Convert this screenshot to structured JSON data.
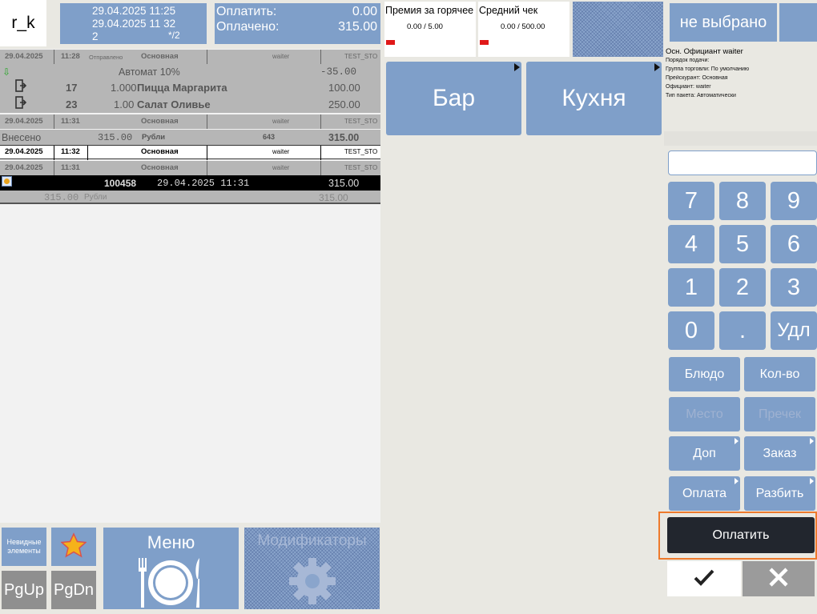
{
  "header": {
    "logo": "r_k",
    "order": {
      "opened": "29.04.2025 11:25",
      "closed": "29.04.2025 11 32",
      "guests": "2",
      "fraction": "*/2"
    },
    "payment": {
      "to_pay_label": "Оплатить:",
      "to_pay": "0.00",
      "paid_label": "Оплачено:",
      "paid": "315.00"
    },
    "stats": [
      {
        "title": "Премия за горячее",
        "value": "0.00 / 5.00"
      },
      {
        "title": "Средний чек",
        "value": "0.00 / 500.00"
      }
    ]
  },
  "order_list": {
    "sessions": [
      {
        "date": "29.04.2025",
        "time": "11:28",
        "status": "Отправлено",
        "menu": "Основная",
        "waiter": "waiter",
        "station": "TEST_STO"
      },
      {
        "date": "29.04.2025",
        "time": "11:31",
        "status": "",
        "menu": "Основная",
        "waiter": "waiter",
        "station": "TEST_STO"
      },
      {
        "date": "29.04.2025",
        "time": "11:32",
        "status": "",
        "menu": "Основная",
        "waiter": "waiter",
        "station": "TEST_STO"
      },
      {
        "date": "29.04.2025",
        "time": "11:31",
        "status": "",
        "menu": "Основная",
        "waiter": "waiter",
        "station": "TEST_STO"
      }
    ],
    "discount": {
      "name": "Автомат 10%",
      "amount": "-35.00"
    },
    "items": [
      {
        "code": "17",
        "qty": "1.000",
        "name": "Пицца Маргарита",
        "price": "100.00"
      },
      {
        "code": "23",
        "qty": "1.00",
        "name": "Салат Оливье",
        "price": "250.00"
      }
    ],
    "deposit": {
      "label": "Внесено",
      "amount": "315.00",
      "currency": "Рубли",
      "code": "643",
      "total": "315.00"
    },
    "receipt": {
      "number": "100458",
      "datetime": "29.04.2025 11:31",
      "amount": "315.00",
      "sub_amount": "315.00",
      "sub_currency": "Рубли",
      "sub_total": "315.00"
    }
  },
  "categories": [
    {
      "label": "Бар"
    },
    {
      "label": "Кухня"
    }
  ],
  "right_panel": {
    "waiter_select": "не выбрано",
    "info_title": "Осн. Официант  waiter",
    "info_lines": [
      "Порядок подачи:",
      "Группа торговли: По умолчанию",
      "Прейскурант: Основная",
      "Официант: waiter",
      "Тип пакета: Автоматически"
    ],
    "keypad": [
      "7",
      "8",
      "9",
      "4",
      "5",
      "6",
      "1",
      "2",
      "3",
      "0",
      ".",
      "Удл"
    ],
    "functions": [
      "Блюдо",
      "Кол-во",
      "Место",
      "Пречек",
      "Доп",
      "Заказ",
      "Оплата",
      "Разбить"
    ],
    "pay_button": "Оплатить"
  },
  "bottom": {
    "hidden_elements": "Невидные элементы",
    "page_up": "PgUp",
    "page_down": "PgDn",
    "menu": "Меню",
    "modifiers": "Модификаторы"
  }
}
